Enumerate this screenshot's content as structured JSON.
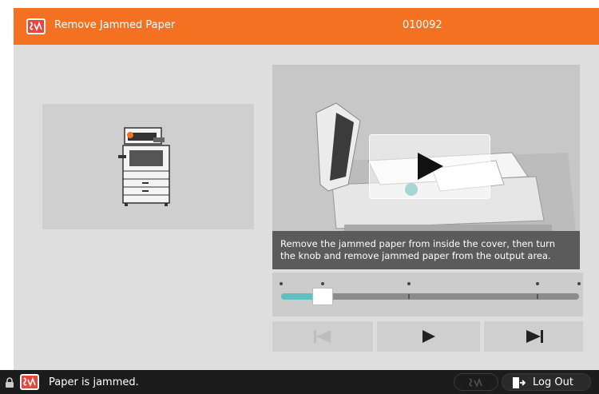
{
  "header": {
    "title": "Remove Jammed Paper",
    "code": "010092",
    "icon": "error-status-icon",
    "accent_color": "#f47121"
  },
  "video": {
    "caption_line1": "Remove the jammed paper from inside the cover, then turn",
    "caption_line2": "the knob and remove jammed paper from the output area.",
    "play_icon": "play-icon"
  },
  "timeline": {
    "progress_fraction": 0.14,
    "marker_fractions": [
      0.0,
      0.14,
      0.43,
      0.86,
      1.0
    ],
    "fill_color": "#5ec0c2"
  },
  "controls": {
    "previous_icon": "skip-previous-icon",
    "previous_enabled": false,
    "play_icon": "play-icon",
    "next_icon": "skip-next-icon"
  },
  "statusbar": {
    "message": "Paper is jammed.",
    "logout_label": "Log Out",
    "lock_icon": "lock-icon",
    "status_icon": "error-status-icon",
    "logout_icon": "logout-icon"
  }
}
